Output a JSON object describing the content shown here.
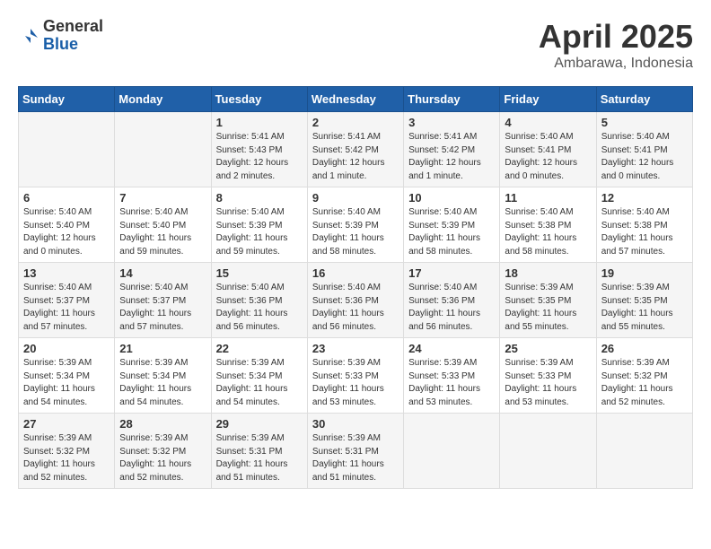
{
  "header": {
    "logo_general": "General",
    "logo_blue": "Blue",
    "month_title": "April 2025",
    "location": "Ambarawa, Indonesia"
  },
  "weekdays": [
    "Sunday",
    "Monday",
    "Tuesday",
    "Wednesday",
    "Thursday",
    "Friday",
    "Saturday"
  ],
  "weeks": [
    [
      {
        "day": "",
        "info": ""
      },
      {
        "day": "",
        "info": ""
      },
      {
        "day": "1",
        "info": "Sunrise: 5:41 AM\nSunset: 5:43 PM\nDaylight: 12 hours\nand 2 minutes."
      },
      {
        "day": "2",
        "info": "Sunrise: 5:41 AM\nSunset: 5:42 PM\nDaylight: 12 hours\nand 1 minute."
      },
      {
        "day": "3",
        "info": "Sunrise: 5:41 AM\nSunset: 5:42 PM\nDaylight: 12 hours\nand 1 minute."
      },
      {
        "day": "4",
        "info": "Sunrise: 5:40 AM\nSunset: 5:41 PM\nDaylight: 12 hours\nand 0 minutes."
      },
      {
        "day": "5",
        "info": "Sunrise: 5:40 AM\nSunset: 5:41 PM\nDaylight: 12 hours\nand 0 minutes."
      }
    ],
    [
      {
        "day": "6",
        "info": "Sunrise: 5:40 AM\nSunset: 5:40 PM\nDaylight: 12 hours\nand 0 minutes."
      },
      {
        "day": "7",
        "info": "Sunrise: 5:40 AM\nSunset: 5:40 PM\nDaylight: 11 hours\nand 59 minutes."
      },
      {
        "day": "8",
        "info": "Sunrise: 5:40 AM\nSunset: 5:39 PM\nDaylight: 11 hours\nand 59 minutes."
      },
      {
        "day": "9",
        "info": "Sunrise: 5:40 AM\nSunset: 5:39 PM\nDaylight: 11 hours\nand 58 minutes."
      },
      {
        "day": "10",
        "info": "Sunrise: 5:40 AM\nSunset: 5:39 PM\nDaylight: 11 hours\nand 58 minutes."
      },
      {
        "day": "11",
        "info": "Sunrise: 5:40 AM\nSunset: 5:38 PM\nDaylight: 11 hours\nand 58 minutes."
      },
      {
        "day": "12",
        "info": "Sunrise: 5:40 AM\nSunset: 5:38 PM\nDaylight: 11 hours\nand 57 minutes."
      }
    ],
    [
      {
        "day": "13",
        "info": "Sunrise: 5:40 AM\nSunset: 5:37 PM\nDaylight: 11 hours\nand 57 minutes."
      },
      {
        "day": "14",
        "info": "Sunrise: 5:40 AM\nSunset: 5:37 PM\nDaylight: 11 hours\nand 57 minutes."
      },
      {
        "day": "15",
        "info": "Sunrise: 5:40 AM\nSunset: 5:36 PM\nDaylight: 11 hours\nand 56 minutes."
      },
      {
        "day": "16",
        "info": "Sunrise: 5:40 AM\nSunset: 5:36 PM\nDaylight: 11 hours\nand 56 minutes."
      },
      {
        "day": "17",
        "info": "Sunrise: 5:40 AM\nSunset: 5:36 PM\nDaylight: 11 hours\nand 56 minutes."
      },
      {
        "day": "18",
        "info": "Sunrise: 5:39 AM\nSunset: 5:35 PM\nDaylight: 11 hours\nand 55 minutes."
      },
      {
        "day": "19",
        "info": "Sunrise: 5:39 AM\nSunset: 5:35 PM\nDaylight: 11 hours\nand 55 minutes."
      }
    ],
    [
      {
        "day": "20",
        "info": "Sunrise: 5:39 AM\nSunset: 5:34 PM\nDaylight: 11 hours\nand 54 minutes."
      },
      {
        "day": "21",
        "info": "Sunrise: 5:39 AM\nSunset: 5:34 PM\nDaylight: 11 hours\nand 54 minutes."
      },
      {
        "day": "22",
        "info": "Sunrise: 5:39 AM\nSunset: 5:34 PM\nDaylight: 11 hours\nand 54 minutes."
      },
      {
        "day": "23",
        "info": "Sunrise: 5:39 AM\nSunset: 5:33 PM\nDaylight: 11 hours\nand 53 minutes."
      },
      {
        "day": "24",
        "info": "Sunrise: 5:39 AM\nSunset: 5:33 PM\nDaylight: 11 hours\nand 53 minutes."
      },
      {
        "day": "25",
        "info": "Sunrise: 5:39 AM\nSunset: 5:33 PM\nDaylight: 11 hours\nand 53 minutes."
      },
      {
        "day": "26",
        "info": "Sunrise: 5:39 AM\nSunset: 5:32 PM\nDaylight: 11 hours\nand 52 minutes."
      }
    ],
    [
      {
        "day": "27",
        "info": "Sunrise: 5:39 AM\nSunset: 5:32 PM\nDaylight: 11 hours\nand 52 minutes."
      },
      {
        "day": "28",
        "info": "Sunrise: 5:39 AM\nSunset: 5:32 PM\nDaylight: 11 hours\nand 52 minutes."
      },
      {
        "day": "29",
        "info": "Sunrise: 5:39 AM\nSunset: 5:31 PM\nDaylight: 11 hours\nand 51 minutes."
      },
      {
        "day": "30",
        "info": "Sunrise: 5:39 AM\nSunset: 5:31 PM\nDaylight: 11 hours\nand 51 minutes."
      },
      {
        "day": "",
        "info": ""
      },
      {
        "day": "",
        "info": ""
      },
      {
        "day": "",
        "info": ""
      }
    ]
  ]
}
